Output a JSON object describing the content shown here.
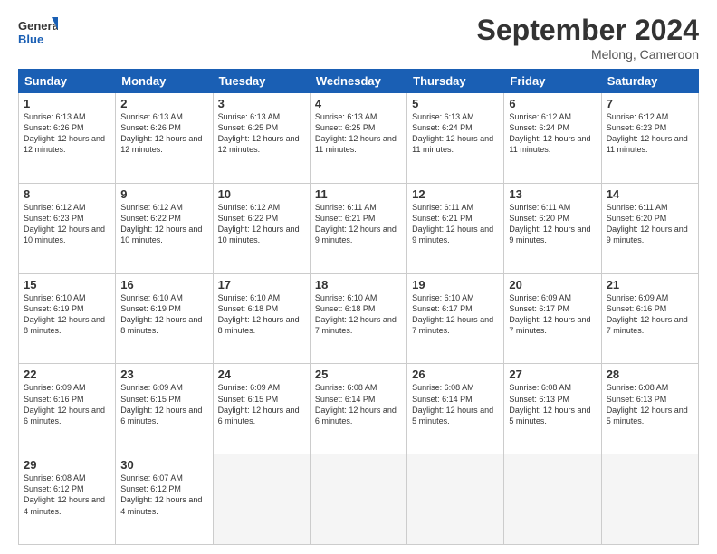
{
  "logo": {
    "general": "General",
    "blue": "Blue"
  },
  "title": "September 2024",
  "location": "Melong, Cameroon",
  "days_of_week": [
    "Sunday",
    "Monday",
    "Tuesday",
    "Wednesday",
    "Thursday",
    "Friday",
    "Saturday"
  ],
  "weeks": [
    [
      {
        "day": "1",
        "info": "Sunrise: 6:13 AM\nSunset: 6:26 PM\nDaylight: 12 hours and 12 minutes."
      },
      {
        "day": "2",
        "info": "Sunrise: 6:13 AM\nSunset: 6:26 PM\nDaylight: 12 hours and 12 minutes."
      },
      {
        "day": "3",
        "info": "Sunrise: 6:13 AM\nSunset: 6:25 PM\nDaylight: 12 hours and 12 minutes."
      },
      {
        "day": "4",
        "info": "Sunrise: 6:13 AM\nSunset: 6:25 PM\nDaylight: 12 hours and 11 minutes."
      },
      {
        "day": "5",
        "info": "Sunrise: 6:13 AM\nSunset: 6:24 PM\nDaylight: 12 hours and 11 minutes."
      },
      {
        "day": "6",
        "info": "Sunrise: 6:12 AM\nSunset: 6:24 PM\nDaylight: 12 hours and 11 minutes."
      },
      {
        "day": "7",
        "info": "Sunrise: 6:12 AM\nSunset: 6:23 PM\nDaylight: 12 hours and 11 minutes."
      }
    ],
    [
      {
        "day": "8",
        "info": "Sunrise: 6:12 AM\nSunset: 6:23 PM\nDaylight: 12 hours and 10 minutes."
      },
      {
        "day": "9",
        "info": "Sunrise: 6:12 AM\nSunset: 6:22 PM\nDaylight: 12 hours and 10 minutes."
      },
      {
        "day": "10",
        "info": "Sunrise: 6:12 AM\nSunset: 6:22 PM\nDaylight: 12 hours and 10 minutes."
      },
      {
        "day": "11",
        "info": "Sunrise: 6:11 AM\nSunset: 6:21 PM\nDaylight: 12 hours and 9 minutes."
      },
      {
        "day": "12",
        "info": "Sunrise: 6:11 AM\nSunset: 6:21 PM\nDaylight: 12 hours and 9 minutes."
      },
      {
        "day": "13",
        "info": "Sunrise: 6:11 AM\nSunset: 6:20 PM\nDaylight: 12 hours and 9 minutes."
      },
      {
        "day": "14",
        "info": "Sunrise: 6:11 AM\nSunset: 6:20 PM\nDaylight: 12 hours and 9 minutes."
      }
    ],
    [
      {
        "day": "15",
        "info": "Sunrise: 6:10 AM\nSunset: 6:19 PM\nDaylight: 12 hours and 8 minutes."
      },
      {
        "day": "16",
        "info": "Sunrise: 6:10 AM\nSunset: 6:19 PM\nDaylight: 12 hours and 8 minutes."
      },
      {
        "day": "17",
        "info": "Sunrise: 6:10 AM\nSunset: 6:18 PM\nDaylight: 12 hours and 8 minutes."
      },
      {
        "day": "18",
        "info": "Sunrise: 6:10 AM\nSunset: 6:18 PM\nDaylight: 12 hours and 7 minutes."
      },
      {
        "day": "19",
        "info": "Sunrise: 6:10 AM\nSunset: 6:17 PM\nDaylight: 12 hours and 7 minutes."
      },
      {
        "day": "20",
        "info": "Sunrise: 6:09 AM\nSunset: 6:17 PM\nDaylight: 12 hours and 7 minutes."
      },
      {
        "day": "21",
        "info": "Sunrise: 6:09 AM\nSunset: 6:16 PM\nDaylight: 12 hours and 7 minutes."
      }
    ],
    [
      {
        "day": "22",
        "info": "Sunrise: 6:09 AM\nSunset: 6:16 PM\nDaylight: 12 hours and 6 minutes."
      },
      {
        "day": "23",
        "info": "Sunrise: 6:09 AM\nSunset: 6:15 PM\nDaylight: 12 hours and 6 minutes."
      },
      {
        "day": "24",
        "info": "Sunrise: 6:09 AM\nSunset: 6:15 PM\nDaylight: 12 hours and 6 minutes."
      },
      {
        "day": "25",
        "info": "Sunrise: 6:08 AM\nSunset: 6:14 PM\nDaylight: 12 hours and 6 minutes."
      },
      {
        "day": "26",
        "info": "Sunrise: 6:08 AM\nSunset: 6:14 PM\nDaylight: 12 hours and 5 minutes."
      },
      {
        "day": "27",
        "info": "Sunrise: 6:08 AM\nSunset: 6:13 PM\nDaylight: 12 hours and 5 minutes."
      },
      {
        "day": "28",
        "info": "Sunrise: 6:08 AM\nSunset: 6:13 PM\nDaylight: 12 hours and 5 minutes."
      }
    ],
    [
      {
        "day": "29",
        "info": "Sunrise: 6:08 AM\nSunset: 6:12 PM\nDaylight: 12 hours and 4 minutes."
      },
      {
        "day": "30",
        "info": "Sunrise: 6:07 AM\nSunset: 6:12 PM\nDaylight: 12 hours and 4 minutes."
      },
      {
        "day": "",
        "info": ""
      },
      {
        "day": "",
        "info": ""
      },
      {
        "day": "",
        "info": ""
      },
      {
        "day": "",
        "info": ""
      },
      {
        "day": "",
        "info": ""
      }
    ]
  ]
}
